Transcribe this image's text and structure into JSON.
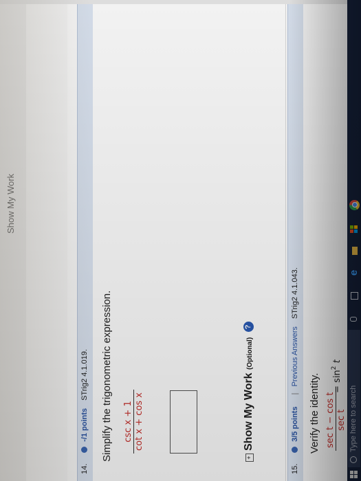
{
  "previous_strip_text": "Show My Work",
  "question14": {
    "number": "14.",
    "points": "-/1 points",
    "code": "STrig2 4.1.019.",
    "prompt": "Simplify the trigonometric expression.",
    "fraction_numerator": "csc x + 1",
    "fraction_denominator": "cot x + cos x",
    "answer_value": "",
    "show_work_label": "Show My Work",
    "show_work_optional": "(Optional)",
    "help_symbol": "?"
  },
  "question15": {
    "number": "15.",
    "points": "3/5 points",
    "separator": "|",
    "previous_answers": "Previous Answers",
    "code": "STrig2 4.1.043.",
    "prompt": "Verify the identity.",
    "fraction_numerator": "sec t − cos t",
    "fraction_denominator": "sec t",
    "equals": "=",
    "rhs_func": "sin",
    "rhs_exp": "2",
    "rhs_var": "t"
  },
  "taskbar": {
    "search_placeholder": "Type here to search"
  },
  "colors": {
    "header_bg": "#dde6f3",
    "link_blue": "#2c56a6",
    "answer_red": "#c9302c",
    "taskbar_bg": "#16223c"
  }
}
